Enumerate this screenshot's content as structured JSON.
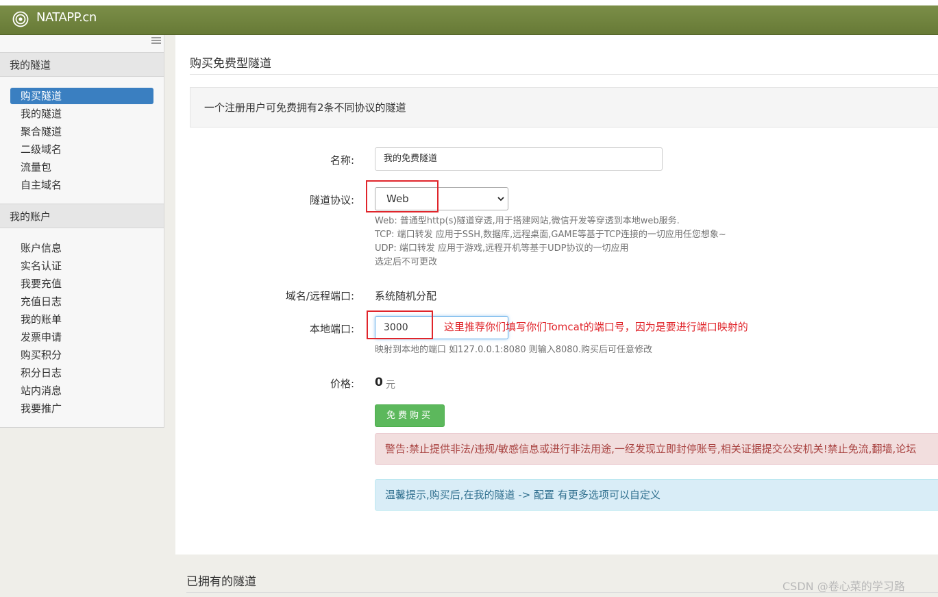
{
  "header": {
    "brand": "NATAPP.cn",
    "brand_color": "#6f8340"
  },
  "sidebar": {
    "tunnels_heading": "我的隧道",
    "tunnel_items": [
      {
        "label": "购买隧道",
        "active": true
      },
      {
        "label": "我的隧道",
        "active": false
      },
      {
        "label": "聚合隧道",
        "active": false
      },
      {
        "label": "二级域名",
        "active": false
      },
      {
        "label": "流量包",
        "active": false
      },
      {
        "label": "自主域名",
        "active": false
      }
    ],
    "account_heading": "我的账户",
    "account_items": [
      {
        "label": "账户信息"
      },
      {
        "label": "实名认证"
      },
      {
        "label": "我要充值"
      },
      {
        "label": "充值日志"
      },
      {
        "label": "我的账单"
      },
      {
        "label": "发票申请"
      },
      {
        "label": "购买积分"
      },
      {
        "label": "积分日志"
      },
      {
        "label": "站内消息"
      },
      {
        "label": "我要推广"
      }
    ]
  },
  "main": {
    "title": "购买免费型隧道",
    "notice": "一个注册用户可免费拥有2条不同协议的隧道",
    "form": {
      "name_label": "名称:",
      "name_value": "我的免费隧道",
      "protocol_label": "隧道协议:",
      "protocol_value": "Web",
      "protocol_help": [
        "Web: 普通型http(s)隧道穿透,用于搭建网站,微信开发等穿透到本地web服务.",
        "TCP: 端口转发 应用于SSH,数据库,远程桌面,GAME等基于TCP连接的一切应用任您想象~",
        "UDP: 端口转发 应用于游戏,远程开机等基于UDP协议的一切应用",
        "选定后不可更改"
      ],
      "domain_label": "域名/远程端口:",
      "domain_value": "系统随机分配",
      "port_label": "本地端口:",
      "port_value": "3000",
      "port_help": "映射到本地的端口 如127.0.0.1:8080 则输入8080.购买后可任意修改",
      "annotation": "这里推荐你们填写你们Tomcat的端口号，因为是要进行端口映射的",
      "price_label": "价格:",
      "price_value": "0",
      "price_unit": "元",
      "buy_button": "免费购买"
    },
    "warning": "警告:禁止提供非法/违规/敏感信息或进行非法用途,一经发现立即封停账号,相关证据提交公安机关!禁止免流,翻墙,论坛",
    "tip": "温馨提示,购买后,在我的隧道 -> 配置 有更多选项可以自定义"
  },
  "owned": {
    "title": "已拥有的隧道"
  },
  "watermark": "CSDN @卷心菜的学习路"
}
